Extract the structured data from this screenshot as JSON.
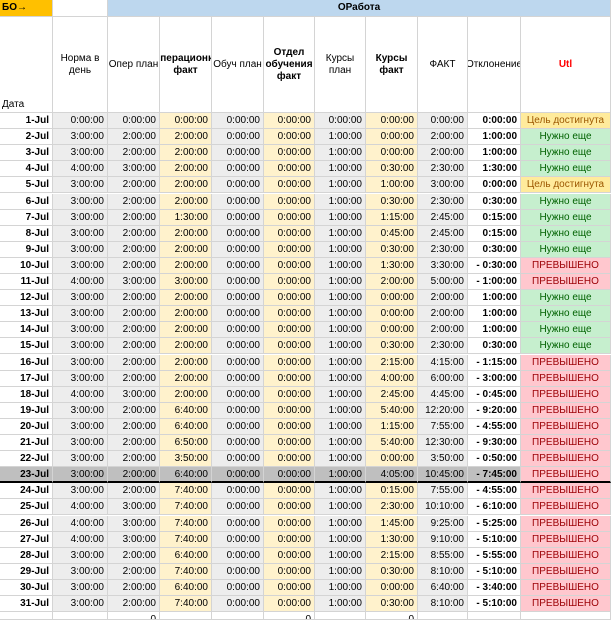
{
  "corner_label": "БО→",
  "group_header": "ОРабота",
  "date_label": "Дата",
  "columns": [
    {
      "label": "Норма в день",
      "bold": false
    },
    {
      "label": "Опер план",
      "bold": false
    },
    {
      "label": "Операционка факт",
      "bold": true
    },
    {
      "label": "Обуч план",
      "bold": false
    },
    {
      "label": "Отдел обучения факт",
      "bold": true
    },
    {
      "label": "Курсы план",
      "bold": false
    },
    {
      "label": "Курсы факт",
      "bold": true
    },
    {
      "label": "ФАКТ",
      "bold": false
    },
    {
      "label": "Отклонение",
      "bold": false
    },
    {
      "label": "Utl",
      "bold": true
    }
  ],
  "colors": {
    "utl_header": "#ff0000",
    "group_header_bg": "#bdd7ee",
    "corner_bg": "#ffc000"
  },
  "rows": [
    [
      "1-Jul",
      "0:00:00",
      "0:00:00",
      "0:00:00",
      "0:00:00",
      "0:00:00",
      "0:00:00",
      "0:00:00",
      "0:00:00",
      "0:00:00",
      "Цель достигнута"
    ],
    [
      "2-Jul",
      "3:00:00",
      "2:00:00",
      "2:00:00",
      "0:00:00",
      "0:00:00",
      "1:00:00",
      "0:00:00",
      "2:00:00",
      "1:00:00",
      "Нужно еще"
    ],
    [
      "3-Jul",
      "3:00:00",
      "2:00:00",
      "2:00:00",
      "0:00:00",
      "0:00:00",
      "1:00:00",
      "0:00:00",
      "2:00:00",
      "1:00:00",
      "Нужно еще"
    ],
    [
      "4-Jul",
      "4:00:00",
      "3:00:00",
      "2:00:00",
      "0:00:00",
      "0:00:00",
      "1:00:00",
      "0:30:00",
      "2:30:00",
      "1:30:00",
      "Нужно еще"
    ],
    [
      "5-Jul",
      "3:00:00",
      "2:00:00",
      "2:00:00",
      "0:00:00",
      "0:00:00",
      "1:00:00",
      "1:00:00",
      "3:00:00",
      "0:00:00",
      "Цель достигнута"
    ],
    [
      "6-Jul",
      "3:00:00",
      "2:00:00",
      "2:00:00",
      "0:00:00",
      "0:00:00",
      "1:00:00",
      "0:30:00",
      "2:30:00",
      "0:30:00",
      "Нужно еще"
    ],
    [
      "7-Jul",
      "3:00:00",
      "2:00:00",
      "1:30:00",
      "0:00:00",
      "0:00:00",
      "1:00:00",
      "1:15:00",
      "2:45:00",
      "0:15:00",
      "Нужно еще"
    ],
    [
      "8-Jul",
      "3:00:00",
      "2:00:00",
      "2:00:00",
      "0:00:00",
      "0:00:00",
      "1:00:00",
      "0:45:00",
      "2:45:00",
      "0:15:00",
      "Нужно еще"
    ],
    [
      "9-Jul",
      "3:00:00",
      "2:00:00",
      "2:00:00",
      "0:00:00",
      "0:00:00",
      "1:00:00",
      "0:30:00",
      "2:30:00",
      "0:30:00",
      "Нужно еще"
    ],
    [
      "10-Jul",
      "3:00:00",
      "2:00:00",
      "2:00:00",
      "0:00:00",
      "0:00:00",
      "1:00:00",
      "1:30:00",
      "3:30:00",
      "- 0:30:00",
      "ПРЕВЫШЕНО"
    ],
    [
      "11-Jul",
      "4:00:00",
      "3:00:00",
      "3:00:00",
      "0:00:00",
      "0:00:00",
      "1:00:00",
      "2:00:00",
      "5:00:00",
      "- 1:00:00",
      "ПРЕВЫШЕНО"
    ],
    [
      "12-Jul",
      "3:00:00",
      "2:00:00",
      "2:00:00",
      "0:00:00",
      "0:00:00",
      "1:00:00",
      "0:00:00",
      "2:00:00",
      "1:00:00",
      "Нужно еще"
    ],
    [
      "13-Jul",
      "3:00:00",
      "2:00:00",
      "2:00:00",
      "0:00:00",
      "0:00:00",
      "1:00:00",
      "0:00:00",
      "2:00:00",
      "1:00:00",
      "Нужно еще"
    ],
    [
      "14-Jul",
      "3:00:00",
      "2:00:00",
      "2:00:00",
      "0:00:00",
      "0:00:00",
      "1:00:00",
      "0:00:00",
      "2:00:00",
      "1:00:00",
      "Нужно еще"
    ],
    [
      "15-Jul",
      "3:00:00",
      "2:00:00",
      "2:00:00",
      "0:00:00",
      "0:00:00",
      "1:00:00",
      "0:30:00",
      "2:30:00",
      "0:30:00",
      "Нужно еще"
    ],
    [
      "16-Jul",
      "3:00:00",
      "2:00:00",
      "2:00:00",
      "0:00:00",
      "0:00:00",
      "1:00:00",
      "2:15:00",
      "4:15:00",
      "- 1:15:00",
      "ПРЕВЫШЕНО"
    ],
    [
      "17-Jul",
      "3:00:00",
      "2:00:00",
      "2:00:00",
      "0:00:00",
      "0:00:00",
      "1:00:00",
      "4:00:00",
      "6:00:00",
      "- 3:00:00",
      "ПРЕВЫШЕНО"
    ],
    [
      "18-Jul",
      "4:00:00",
      "3:00:00",
      "2:00:00",
      "0:00:00",
      "0:00:00",
      "1:00:00",
      "2:45:00",
      "4:45:00",
      "- 0:45:00",
      "ПРЕВЫШЕНО"
    ],
    [
      "19-Jul",
      "3:00:00",
      "2:00:00",
      "6:40:00",
      "0:00:00",
      "0:00:00",
      "1:00:00",
      "5:40:00",
      "12:20:00",
      "- 9:20:00",
      "ПРЕВЫШЕНО"
    ],
    [
      "20-Jul",
      "3:00:00",
      "2:00:00",
      "6:40:00",
      "0:00:00",
      "0:00:00",
      "1:00:00",
      "1:15:00",
      "7:55:00",
      "- 4:55:00",
      "ПРЕВЫШЕНО"
    ],
    [
      "21-Jul",
      "3:00:00",
      "2:00:00",
      "6:50:00",
      "0:00:00",
      "0:00:00",
      "1:00:00",
      "5:40:00",
      "12:30:00",
      "- 9:30:00",
      "ПРЕВЫШЕНО"
    ],
    [
      "22-Jul",
      "3:00:00",
      "2:00:00",
      "3:50:00",
      "0:00:00",
      "0:00:00",
      "1:00:00",
      "0:00:00",
      "3:50:00",
      "- 0:50:00",
      "ПРЕВЫШЕНО"
    ],
    [
      "23-Jul",
      "3:00:00",
      "2:00:00",
      "6:40:00",
      "0:00:00",
      "0:00:00",
      "1:00:00",
      "4:05:00",
      "10:45:00",
      "- 7:45:00",
      "ПРЕВЫШЕНО"
    ],
    [
      "24-Jul",
      "3:00:00",
      "2:00:00",
      "7:40:00",
      "0:00:00",
      "0:00:00",
      "1:00:00",
      "0:15:00",
      "7:55:00",
      "- 4:55:00",
      "ПРЕВЫШЕНО"
    ],
    [
      "25-Jul",
      "4:00:00",
      "3:00:00",
      "7:40:00",
      "0:00:00",
      "0:00:00",
      "1:00:00",
      "2:30:00",
      "10:10:00",
      "- 6:10:00",
      "ПРЕВЫШЕНО"
    ],
    [
      "26-Jul",
      "4:00:00",
      "3:00:00",
      "7:40:00",
      "0:00:00",
      "0:00:00",
      "1:00:00",
      "1:45:00",
      "9:25:00",
      "- 5:25:00",
      "ПРЕВЫШЕНО"
    ],
    [
      "27-Jul",
      "4:00:00",
      "3:00:00",
      "7:40:00",
      "0:00:00",
      "0:00:00",
      "1:00:00",
      "1:30:00",
      "9:10:00",
      "- 5:10:00",
      "ПРЕВЫШЕНО"
    ],
    [
      "28-Jul",
      "3:00:00",
      "2:00:00",
      "6:40:00",
      "0:00:00",
      "0:00:00",
      "1:00:00",
      "2:15:00",
      "8:55:00",
      "- 5:55:00",
      "ПРЕВЫШЕНО"
    ],
    [
      "29-Jul",
      "3:00:00",
      "2:00:00",
      "7:40:00",
      "0:00:00",
      "0:00:00",
      "1:00:00",
      "0:30:00",
      "8:10:00",
      "- 5:10:00",
      "ПРЕВЫШЕНО"
    ],
    [
      "30-Jul",
      "3:00:00",
      "2:00:00",
      "6:40:00",
      "0:00:00",
      "0:00:00",
      "1:00:00",
      "0:00:00",
      "6:40:00",
      "- 3:40:00",
      "ПРЕВЫШЕНО"
    ],
    [
      "31-Jul",
      "3:00:00",
      "2:00:00",
      "7:40:00",
      "0:00:00",
      "0:00:00",
      "1:00:00",
      "0:30:00",
      "8:10:00",
      "- 5:10:00",
      "ПРЕВЫШЕНО"
    ]
  ],
  "selected_row_date": "23-Jul",
  "footer": [
    "",
    "",
    "0",
    "",
    "",
    "0",
    "",
    "0",
    "",
    "",
    ""
  ]
}
